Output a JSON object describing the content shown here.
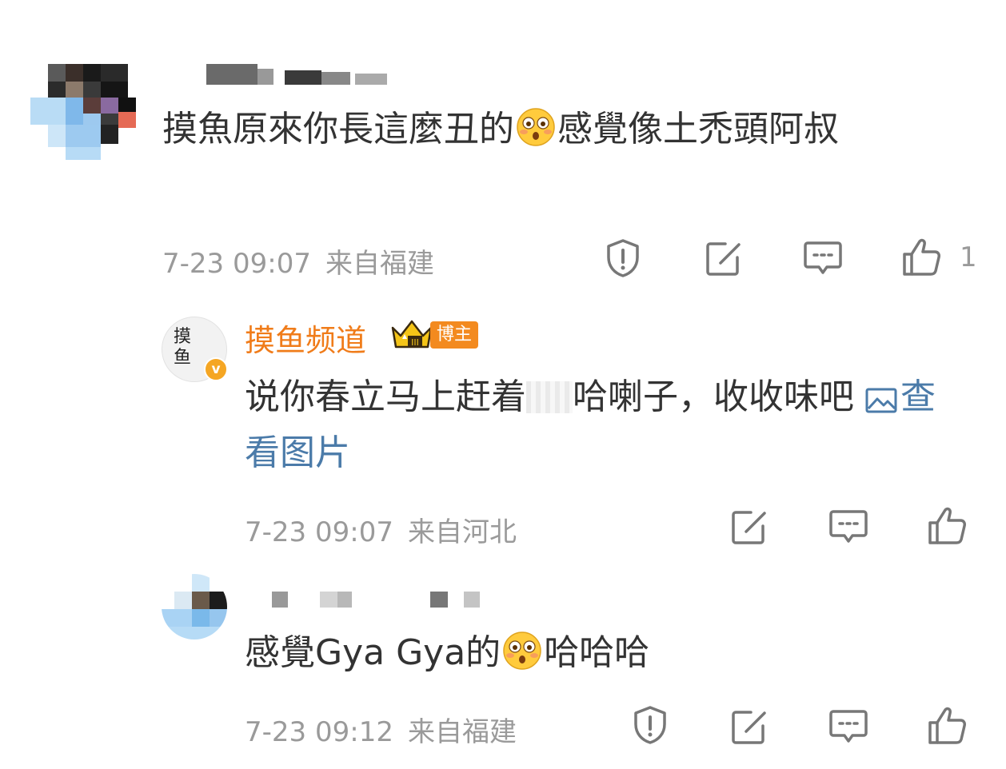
{
  "comments": [
    {
      "text_before_emoji": "摸魚原來你長這麼丑的",
      "emoji": "flushed-face-emoji",
      "text_after_emoji": "感覺像土禿頭阿叔",
      "time": "7-23 09:07",
      "location": "来自福建",
      "like_count": "1"
    },
    {
      "author_name": "摸鱼频道",
      "badge_label": "博主",
      "avatar_text": "摸鱼",
      "text_before_censor": "说你春立马上赶着",
      "text_after_censor": "哈喇子，收收味吧",
      "image_link": "查看图片",
      "time": "7-23 09:07",
      "location": "来自河北"
    },
    {
      "text_before_emoji": "感覺Gya Gya的",
      "emoji": "flushed-face-emoji",
      "text_after_emoji": "哈哈哈",
      "time": "7-23 09:12",
      "location": "来自福建"
    }
  ],
  "colors": {
    "author": "#f07c1a",
    "link": "#4b7ba9",
    "meta": "#9a9a9a",
    "text": "#333333"
  }
}
